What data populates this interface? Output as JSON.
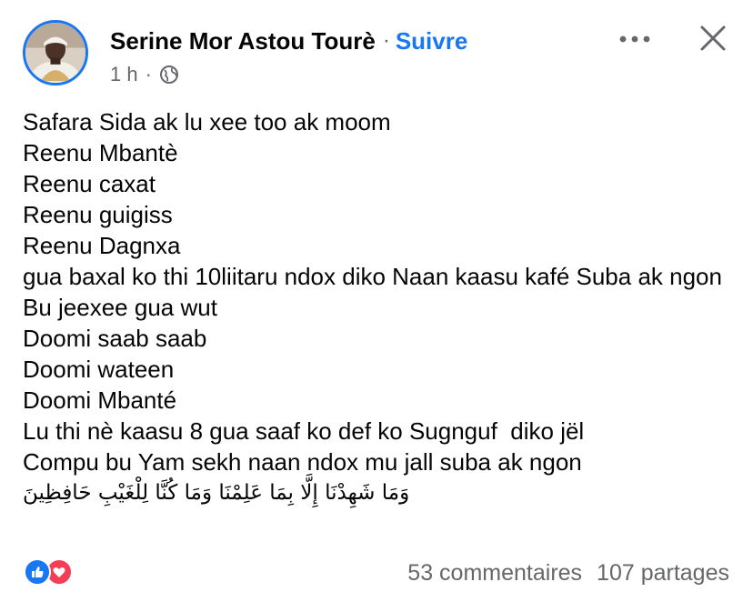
{
  "post": {
    "author": "Serine Mor Astou Tourè",
    "separator": "·",
    "follow_label": "Suivre",
    "time": "1 h",
    "meta_separator": "·",
    "icons": {
      "avatar": "profile-photo",
      "audience": "globe-icon",
      "more": "more-options-icon",
      "close": "close-icon"
    },
    "body_lines": [
      "Safara Sida ak lu xee too ak moom",
      "Reenu Mbantè",
      "Reenu caxat",
      "Reenu guigiss",
      "Reenu Dagnxa",
      "gua baxal ko thi 10liitaru ndox diko Naan kaasu kafé Suba ak ngon",
      "Bu jeexee gua wut",
      "Doomi saab saab",
      "Doomi wateen",
      "Doomi Mbanté",
      "Lu thi nè kaasu 8 gua saaf ko def ko Sugnguf  diko jël",
      "Compu bu Yam sekh naan ndox mu jall suba ak ngon"
    ],
    "arabic_line": "وَمَا شَهِدْنَا إِلَّا بِمَا عَلِمْنَا وَمَا كُنَّا لِلْغَيْبِ حَافِظِينَ",
    "footer": {
      "reactions": [
        "like-icon",
        "love-icon"
      ],
      "comments": "53 commentaires",
      "shares": "107 partages"
    },
    "colors": {
      "accent": "#1877f2",
      "secondary_text": "#65676b",
      "love": "#f33e58"
    }
  }
}
